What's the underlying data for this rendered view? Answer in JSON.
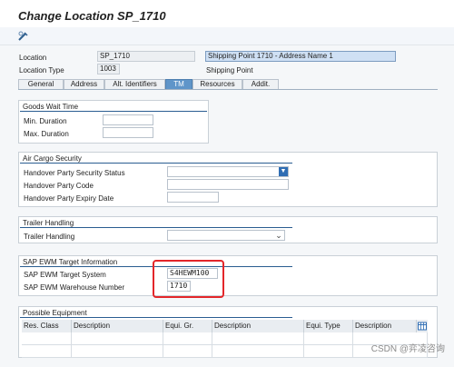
{
  "window": {
    "title": "Change Location SP_1710"
  },
  "header": {
    "location_label": "Location",
    "location_value": "SP_1710",
    "location_description": "Shipping Point 1710 - Address Name 1",
    "location_type_label": "Location Type",
    "location_type_value": "1003",
    "location_type_text": "Shipping Point"
  },
  "tabs": [
    "General",
    "Address",
    "Alt. Identifiers",
    "TM",
    "Resources",
    "Addit."
  ],
  "active_tab": "TM",
  "goods_wait_time": {
    "title": "Goods Wait Time",
    "min_label": "Min. Duration",
    "min_value": "",
    "max_label": "Max. Duration",
    "max_value": ""
  },
  "air_cargo": {
    "title": "Air Cargo Security",
    "status_label": "Handover Party Security Status",
    "status_value": "",
    "code_label": "Handover Party Code",
    "code_value": "",
    "expiry_label": "Handover Party Expiry Date",
    "expiry_value": ""
  },
  "trailer": {
    "title": "Trailer Handling",
    "handling_label": "Trailer Handling",
    "handling_value": ""
  },
  "ewm": {
    "title": "SAP EWM Target Information",
    "system_label": "SAP EWM Target System",
    "system_value": "S4HEWM100",
    "warehouse_label": "SAP EWM Warehouse Number",
    "warehouse_value": "1710"
  },
  "equipment": {
    "title": "Possible Equipment",
    "columns": [
      "Res. Class",
      "Description",
      "Equi. Gr.",
      "Description",
      "Equi. Type",
      "Description"
    ]
  },
  "watermark": "CSDN @弈凌咨询",
  "icons": {
    "toolbar": "display-change-icon",
    "table_settings": "table-settings-icon",
    "dropdown": "chevron-down-icon"
  }
}
